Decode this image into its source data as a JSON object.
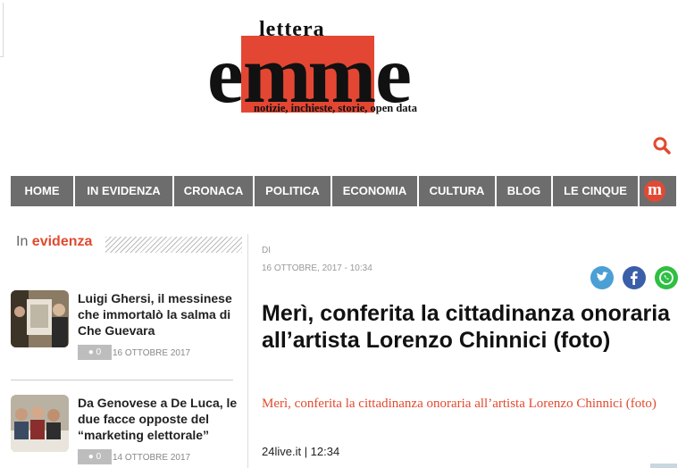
{
  "logo": {
    "top_word": "lettera",
    "left": "e",
    "middle": "mm",
    "right": "e",
    "tagline": "notizie, inchieste, storie, open data"
  },
  "search": {
    "icon": "search-icon"
  },
  "nav": {
    "items": [
      {
        "label": "HOME"
      },
      {
        "label": "IN EVIDENZA"
      },
      {
        "label": "CRONACA"
      },
      {
        "label": "POLITICA"
      },
      {
        "label": "ECONOMIA"
      },
      {
        "label": "CULTURA"
      },
      {
        "label": "BLOG"
      },
      {
        "label": "LE CINQUE"
      }
    ],
    "logo_letter": "m",
    "bg_color": "#6d6d6d"
  },
  "sidebar": {
    "heading_in": "In",
    "heading_evidenza": "evidenza",
    "posts": [
      {
        "title": "Luigi Ghersi, il messinese che immortalò la salma di Che Guevara",
        "comments": "0",
        "date": "16 OTTOBRE 2017"
      },
      {
        "title": "Da Genovese a De Luca, le due facce opposte del “marketing elettorale”",
        "comments": "0",
        "date": "14 OTTOBRE 2017"
      }
    ]
  },
  "article": {
    "by_label": "DI",
    "date": "16 OTTOBRE, 2017 - 10:34",
    "title": "Merì, conferita la cittadinanza onoraria all’artista Lorenzo Chinnici (foto)",
    "subtitle": "Merì, conferita la cittadinanza onoraria all’artista Lorenzo Chinnici (foto)",
    "source": "24live.it | 12:34",
    "share": [
      {
        "icon": "twitter-icon",
        "color": "#4a9fd5"
      },
      {
        "icon": "facebook-icon",
        "color": "#3b5ea8"
      },
      {
        "icon": "whatsapp-icon",
        "color": "#2fbf43"
      }
    ]
  },
  "colors": {
    "accent": "#e14a2e",
    "nav": "#6d6d6d"
  }
}
